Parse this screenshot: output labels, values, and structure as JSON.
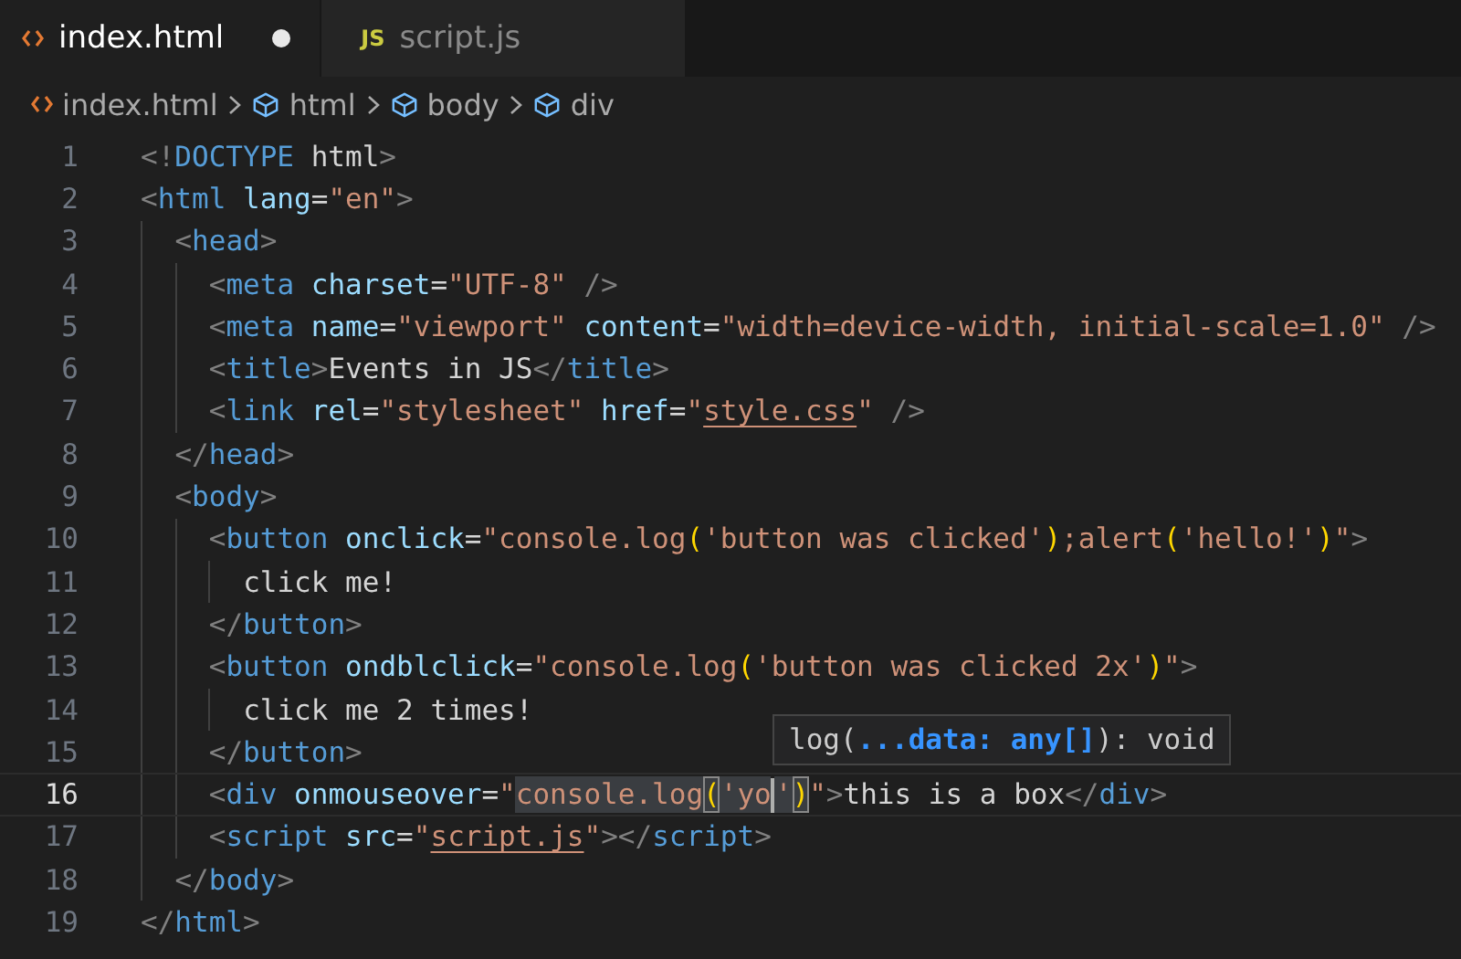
{
  "tabs": [
    {
      "label": "index.html",
      "kind": "html",
      "selected": true,
      "modified": true
    },
    {
      "label": "script.js",
      "kind": "js",
      "badge": "JS",
      "selected": false,
      "modified": false
    }
  ],
  "breadcrumb": [
    {
      "label": "index.html",
      "kind": "file"
    },
    {
      "label": "html",
      "kind": "element"
    },
    {
      "label": "body",
      "kind": "element"
    },
    {
      "label": "div",
      "kind": "element"
    }
  ],
  "editor": {
    "lines": [
      {
        "number": "1",
        "current": false,
        "tokens": [
          {
            "text": "<!",
            "kind": "punct"
          },
          {
            "text": "DOCTYPE",
            "kind": "tag"
          },
          {
            "text": " html",
            "kind": "text"
          },
          {
            "text": ">",
            "kind": "punct"
          }
        ]
      },
      {
        "number": "2",
        "current": false,
        "tokens": [
          {
            "text": "<",
            "kind": "punct"
          },
          {
            "text": "html",
            "kind": "tag"
          },
          {
            "text": " lang",
            "kind": "attr"
          },
          {
            "text": "=",
            "kind": "text"
          },
          {
            "text": "\"en\"",
            "kind": "string"
          },
          {
            "text": ">",
            "kind": "punct"
          }
        ],
        "children": [
          {
            "number": "3",
            "current": false,
            "tokens": [
              {
                "text": "<",
                "kind": "punct"
              },
              {
                "text": "head",
                "kind": "tag"
              },
              {
                "text": ">",
                "kind": "punct"
              }
            ],
            "children": [
              {
                "number": "4",
                "current": false,
                "tokens": [
                  {
                    "text": "<",
                    "kind": "punct"
                  },
                  {
                    "text": "meta",
                    "kind": "tag"
                  },
                  {
                    "text": " charset",
                    "kind": "attr"
                  },
                  {
                    "text": "=",
                    "kind": "text"
                  },
                  {
                    "text": "\"UTF-8\"",
                    "kind": "string"
                  },
                  {
                    "text": " />",
                    "kind": "punct"
                  }
                ]
              },
              {
                "number": "5",
                "current": false,
                "tokens": [
                  {
                    "text": "<",
                    "kind": "punct"
                  },
                  {
                    "text": "meta",
                    "kind": "tag"
                  },
                  {
                    "text": " name",
                    "kind": "attr"
                  },
                  {
                    "text": "=",
                    "kind": "text"
                  },
                  {
                    "text": "\"viewport\"",
                    "kind": "string"
                  },
                  {
                    "text": " content",
                    "kind": "attr"
                  },
                  {
                    "text": "=",
                    "kind": "text"
                  },
                  {
                    "text": "\"width=device-width, initial-scale=1.0\"",
                    "kind": "string"
                  },
                  {
                    "text": " />",
                    "kind": "punct"
                  }
                ]
              },
              {
                "number": "6",
                "current": false,
                "tokens": [
                  {
                    "text": "<",
                    "kind": "punct"
                  },
                  {
                    "text": "title",
                    "kind": "tag"
                  },
                  {
                    "text": ">",
                    "kind": "punct"
                  },
                  {
                    "text": "Events in JS",
                    "kind": "text"
                  },
                  {
                    "text": "</",
                    "kind": "punct"
                  },
                  {
                    "text": "title",
                    "kind": "tag"
                  },
                  {
                    "text": ">",
                    "kind": "punct"
                  }
                ]
              },
              {
                "number": "7",
                "current": false,
                "tokens": [
                  {
                    "text": "<",
                    "kind": "punct"
                  },
                  {
                    "text": "link",
                    "kind": "tag"
                  },
                  {
                    "text": " rel",
                    "kind": "attr"
                  },
                  {
                    "text": "=",
                    "kind": "text"
                  },
                  {
                    "text": "\"stylesheet\"",
                    "kind": "string"
                  },
                  {
                    "text": " href",
                    "kind": "attr"
                  },
                  {
                    "text": "=",
                    "kind": "text"
                  },
                  {
                    "text": "\"",
                    "kind": "string"
                  },
                  {
                    "text": "style.css",
                    "kind": "link"
                  },
                  {
                    "text": "\"",
                    "kind": "string"
                  },
                  {
                    "text": " />",
                    "kind": "punct"
                  }
                ]
              }
            ]
          },
          {
            "number": "8",
            "current": false,
            "tokens": [
              {
                "text": "</",
                "kind": "punct"
              },
              {
                "text": "head",
                "kind": "tag"
              },
              {
                "text": ">",
                "kind": "punct"
              }
            ]
          },
          {
            "number": "9",
            "current": false,
            "tokens": [
              {
                "text": "<",
                "kind": "punct"
              },
              {
                "text": "body",
                "kind": "tag"
              },
              {
                "text": ">",
                "kind": "punct"
              }
            ],
            "children": [
              {
                "number": "10",
                "current": false,
                "tokens": [
                  {
                    "text": "<",
                    "kind": "punct"
                  },
                  {
                    "text": "button",
                    "kind": "tag"
                  },
                  {
                    "text": " onclick",
                    "kind": "attr"
                  },
                  {
                    "text": "=",
                    "kind": "text"
                  },
                  {
                    "text": "\"console.log",
                    "kind": "string"
                  },
                  {
                    "text": "(",
                    "kind": "bracket"
                  },
                  {
                    "text": "'button was clicked'",
                    "kind": "string"
                  },
                  {
                    "text": ")",
                    "kind": "bracket"
                  },
                  {
                    "text": ";alert",
                    "kind": "string"
                  },
                  {
                    "text": "(",
                    "kind": "bracket"
                  },
                  {
                    "text": "'hello!'",
                    "kind": "string"
                  },
                  {
                    "text": ")",
                    "kind": "bracket"
                  },
                  {
                    "text": "\"",
                    "kind": "string"
                  },
                  {
                    "text": ">",
                    "kind": "punct"
                  }
                ],
                "children": [
                  {
                    "number": "11",
                    "current": false,
                    "tokens": [
                      {
                        "text": "click me!",
                        "kind": "text"
                      }
                    ]
                  }
                ]
              },
              {
                "number": "12",
                "current": false,
                "tokens": [
                  {
                    "text": "</",
                    "kind": "punct"
                  },
                  {
                    "text": "button",
                    "kind": "tag"
                  },
                  {
                    "text": ">",
                    "kind": "punct"
                  }
                ]
              },
              {
                "number": "13",
                "current": false,
                "tokens": [
                  {
                    "text": "<",
                    "kind": "punct"
                  },
                  {
                    "text": "button",
                    "kind": "tag"
                  },
                  {
                    "text": " ondblclick",
                    "kind": "attr"
                  },
                  {
                    "text": "=",
                    "kind": "text"
                  },
                  {
                    "text": "\"console.log",
                    "kind": "string"
                  },
                  {
                    "text": "(",
                    "kind": "bracket"
                  },
                  {
                    "text": "'button was clicked 2x'",
                    "kind": "string"
                  },
                  {
                    "text": ")",
                    "kind": "bracket"
                  },
                  {
                    "text": "\"",
                    "kind": "string"
                  },
                  {
                    "text": ">",
                    "kind": "punct"
                  }
                ],
                "children": [
                  {
                    "number": "14",
                    "current": false,
                    "tokens": [
                      {
                        "text": "click me 2 times!",
                        "kind": "text"
                      }
                    ]
                  }
                ]
              },
              {
                "number": "15",
                "current": false,
                "tokens": [
                  {
                    "text": "</",
                    "kind": "punct"
                  },
                  {
                    "text": "button",
                    "kind": "tag"
                  },
                  {
                    "text": ">",
                    "kind": "punct"
                  }
                ]
              },
              {
                "number": "16",
                "current": true,
                "tokens": [
                  {
                    "text": "<",
                    "kind": "punct"
                  },
                  {
                    "text": "div",
                    "kind": "tag"
                  },
                  {
                    "text": " onmouseover",
                    "kind": "attr"
                  },
                  {
                    "text": "=",
                    "kind": "text"
                  },
                  {
                    "text": "\"",
                    "kind": "string"
                  },
                  {
                    "text": "console.log",
                    "kind": "string",
                    "highlighted": true
                  },
                  {
                    "text": "(",
                    "kind": "bracket",
                    "highlighted": true,
                    "matched": true
                  },
                  {
                    "text": "'yo",
                    "kind": "string",
                    "highlighted": true,
                    "cursor_after": true
                  },
                  {
                    "text": "'",
                    "kind": "string",
                    "highlighted": true
                  },
                  {
                    "text": ")",
                    "kind": "bracket",
                    "highlighted": true,
                    "matched": true
                  },
                  {
                    "text": "\"",
                    "kind": "string"
                  },
                  {
                    "text": ">",
                    "kind": "punct"
                  },
                  {
                    "text": "this is a box",
                    "kind": "text"
                  },
                  {
                    "text": "</",
                    "kind": "punct"
                  },
                  {
                    "text": "div",
                    "kind": "tag"
                  },
                  {
                    "text": ">",
                    "kind": "punct"
                  }
                ]
              },
              {
                "number": "17",
                "current": false,
                "tokens": [
                  {
                    "text": "<",
                    "kind": "punct"
                  },
                  {
                    "text": "script",
                    "kind": "tag"
                  },
                  {
                    "text": " src",
                    "kind": "attr"
                  },
                  {
                    "text": "=",
                    "kind": "text"
                  },
                  {
                    "text": "\"",
                    "kind": "string"
                  },
                  {
                    "text": "script.js",
                    "kind": "link"
                  },
                  {
                    "text": "\"",
                    "kind": "string"
                  },
                  {
                    "text": "></",
                    "kind": "punct"
                  },
                  {
                    "text": "script",
                    "kind": "tag"
                  },
                  {
                    "text": ">",
                    "kind": "punct"
                  }
                ]
              }
            ]
          },
          {
            "number": "18",
            "current": false,
            "tokens": [
              {
                "text": "</",
                "kind": "punct"
              },
              {
                "text": "body",
                "kind": "tag"
              },
              {
                "text": ">",
                "kind": "punct"
              }
            ]
          }
        ]
      },
      {
        "number": "19",
        "current": false,
        "tokens": [
          {
            "text": "</",
            "kind": "punct"
          },
          {
            "text": "html",
            "kind": "tag"
          },
          {
            "text": ">",
            "kind": "punct"
          }
        ]
      }
    ]
  },
  "parameter_hint": {
    "tokens": [
      {
        "text": "log(",
        "kind": "text"
      },
      {
        "text": "...data: any[]",
        "kind": "param"
      },
      {
        "text": "): void",
        "kind": "text"
      }
    ]
  }
}
